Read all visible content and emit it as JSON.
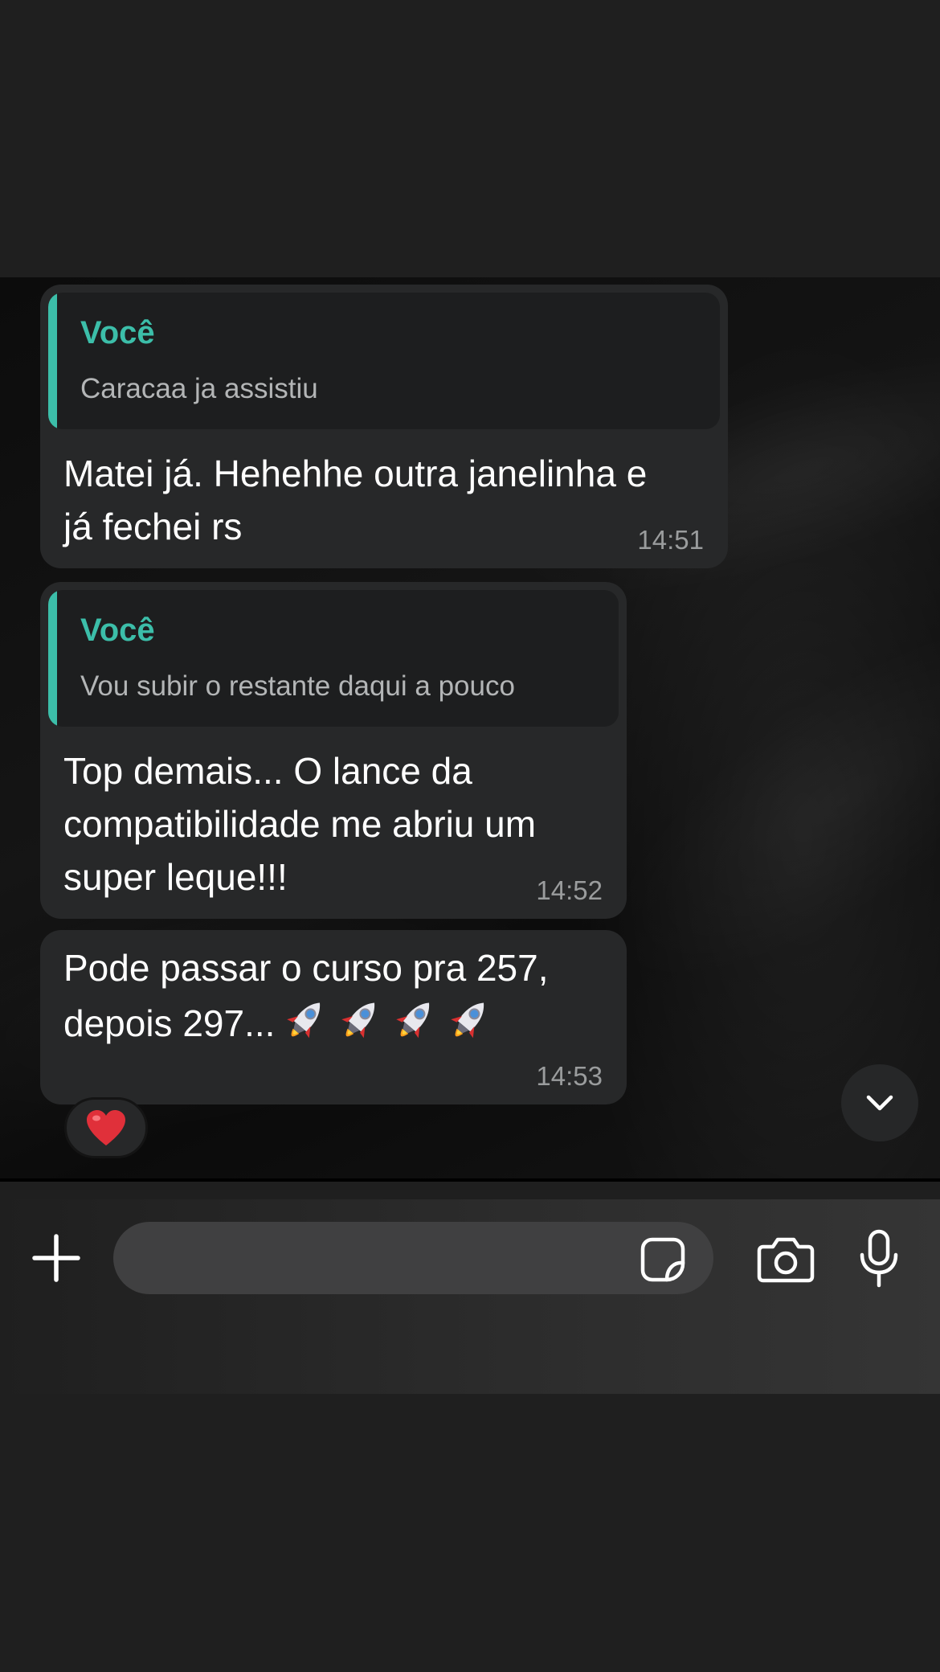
{
  "messages": [
    {
      "quote": {
        "author": "Você",
        "text": "Caracaa ja assistiu"
      },
      "text": "Matei já. Hehehhe outra janelinha e\njá fechei rs",
      "time": "14:51"
    },
    {
      "quote": {
        "author": "Você",
        "text": "Vou subir o restante daqui a pouco"
      },
      "text": "Top demais... O lance da\ncompatibilidade me abriu um\nsuper leque!!!",
      "time": "14:52"
    },
    {
      "text": "Pode passar o curso pra 257,\ndepois 297...",
      "emojis": [
        "rocket-emoji",
        "rocket-emoji",
        "rocket-emoji",
        "rocket-emoji"
      ],
      "time": "14:53",
      "reaction": "heart-emoji"
    }
  ],
  "composer": {
    "placeholder": ""
  },
  "icons": {
    "plus": "plus-icon",
    "sticker": "sticker-icon",
    "camera": "camera-icon",
    "mic": "microphone-icon",
    "scroll": "chevron-down-icon"
  },
  "colors": {
    "accent": "#3cbea9",
    "bubble": "#272829",
    "quote_bg": "#1d1e1f",
    "timestamp": "#9a9c9d",
    "reaction_heart": "#e0303a"
  }
}
